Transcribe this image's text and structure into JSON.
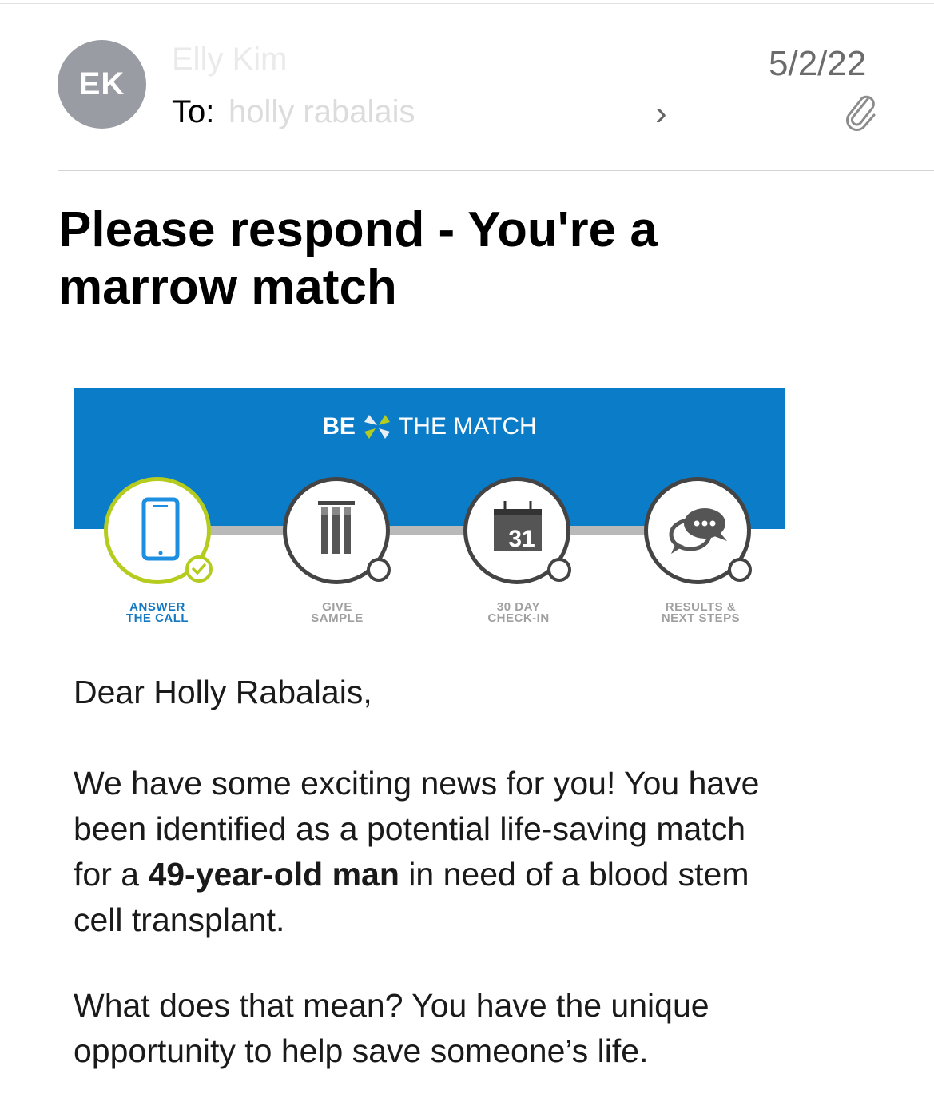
{
  "header": {
    "avatar_initials": "EK",
    "sender_name": "Elly Kim",
    "to_label": "To:",
    "to_value": "holly rabalais",
    "date": "5/2/22",
    "attachment_icon": "paperclip-icon"
  },
  "email": {
    "subject": "Please respond - You're a marrow match",
    "banner": {
      "brand_be": "BE",
      "brand_match": "THE MATCH",
      "steps": [
        {
          "line1": "ANSWER",
          "line2": "THE CALL",
          "icon": "phone-icon",
          "active": true
        },
        {
          "line1": "GIVE",
          "line2": "SAMPLE",
          "icon": "test-tubes-icon",
          "active": false
        },
        {
          "line1": "30 DAY",
          "line2": "CHECK-IN",
          "icon": "calendar-icon",
          "active": false
        },
        {
          "line1": "RESULTS &",
          "line2": "NEXT STEPS",
          "icon": "chat-bubbles-icon",
          "active": false
        }
      ],
      "calendar_day": "31"
    },
    "greeting": "Dear Holly Rabalais,",
    "para1_before": "We have some exciting news for you! You have been identified as a potential life-saving match for a ",
    "para1_bold": "49-year-old man",
    "para1_after": " in need of a blood stem cell transplant.",
    "para2": "What does that mean? You have the unique opportunity to help save someone’s life."
  },
  "colors": {
    "banner_blue": "#0a7cc8",
    "active_green": "#b5cc1f",
    "active_label": "#1479c2",
    "inactive_grey": "#a0a0a0"
  }
}
